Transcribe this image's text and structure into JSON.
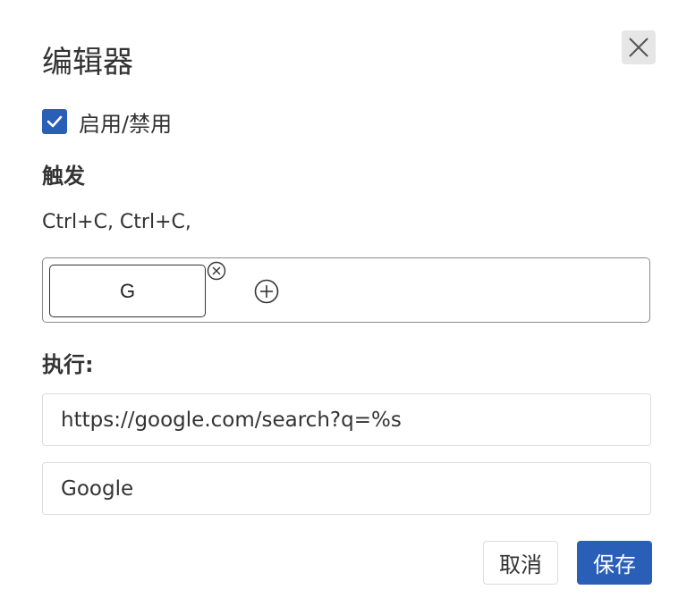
{
  "dialog": {
    "title": "编辑器",
    "close_icon": "close-icon"
  },
  "enable": {
    "checked": true,
    "label": "启用/禁用"
  },
  "trigger": {
    "heading": "触发",
    "keys_text": "Ctrl+C, Ctrl+C,",
    "key_chip": "G",
    "remove_icon": "circle-x-icon",
    "add_icon": "circle-plus-icon"
  },
  "execute": {
    "heading": "执行:",
    "url_value": "https://google.com/search?q=%s",
    "name_value": "Google"
  },
  "actions": {
    "cancel_label": "取消",
    "save_label": "保存"
  },
  "colors": {
    "accent": "#2a5fb8",
    "text": "#333333",
    "close_bg": "#e6e6e6"
  }
}
